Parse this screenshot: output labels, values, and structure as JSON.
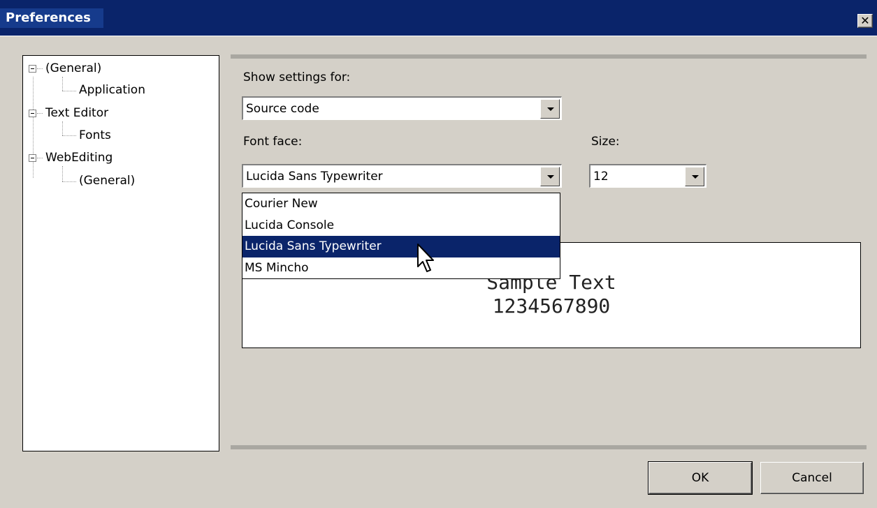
{
  "window": {
    "title": "Preferences",
    "close_glyph": "✕"
  },
  "tree": {
    "nodes": [
      {
        "label": "(General)",
        "expanded": true
      },
      {
        "label": "Application"
      },
      {
        "label": "Text Editor",
        "expanded": true
      },
      {
        "label": "Fonts"
      },
      {
        "label": "WebEditing",
        "expanded": true
      },
      {
        "label": "(General)"
      }
    ]
  },
  "settings": {
    "show_settings_label": "Show settings for:",
    "show_settings_value": "Source code",
    "font_face_label": "Font face:",
    "font_face_value": "Lucida Sans Typewriter",
    "size_label": "Size:",
    "size_value": "12",
    "font_options": [
      "Courier New",
      "Lucida Console",
      "Lucida Sans Typewriter",
      "MS Mincho"
    ],
    "selected_option_index": 2
  },
  "sample": {
    "line1": "Sample Text",
    "line2": "1234567890"
  },
  "buttons": {
    "ok": "OK",
    "cancel": "Cancel"
  },
  "colors": {
    "titlebar": "#0a246a",
    "selection": "#0a246a",
    "face": "#d4d0c8"
  }
}
